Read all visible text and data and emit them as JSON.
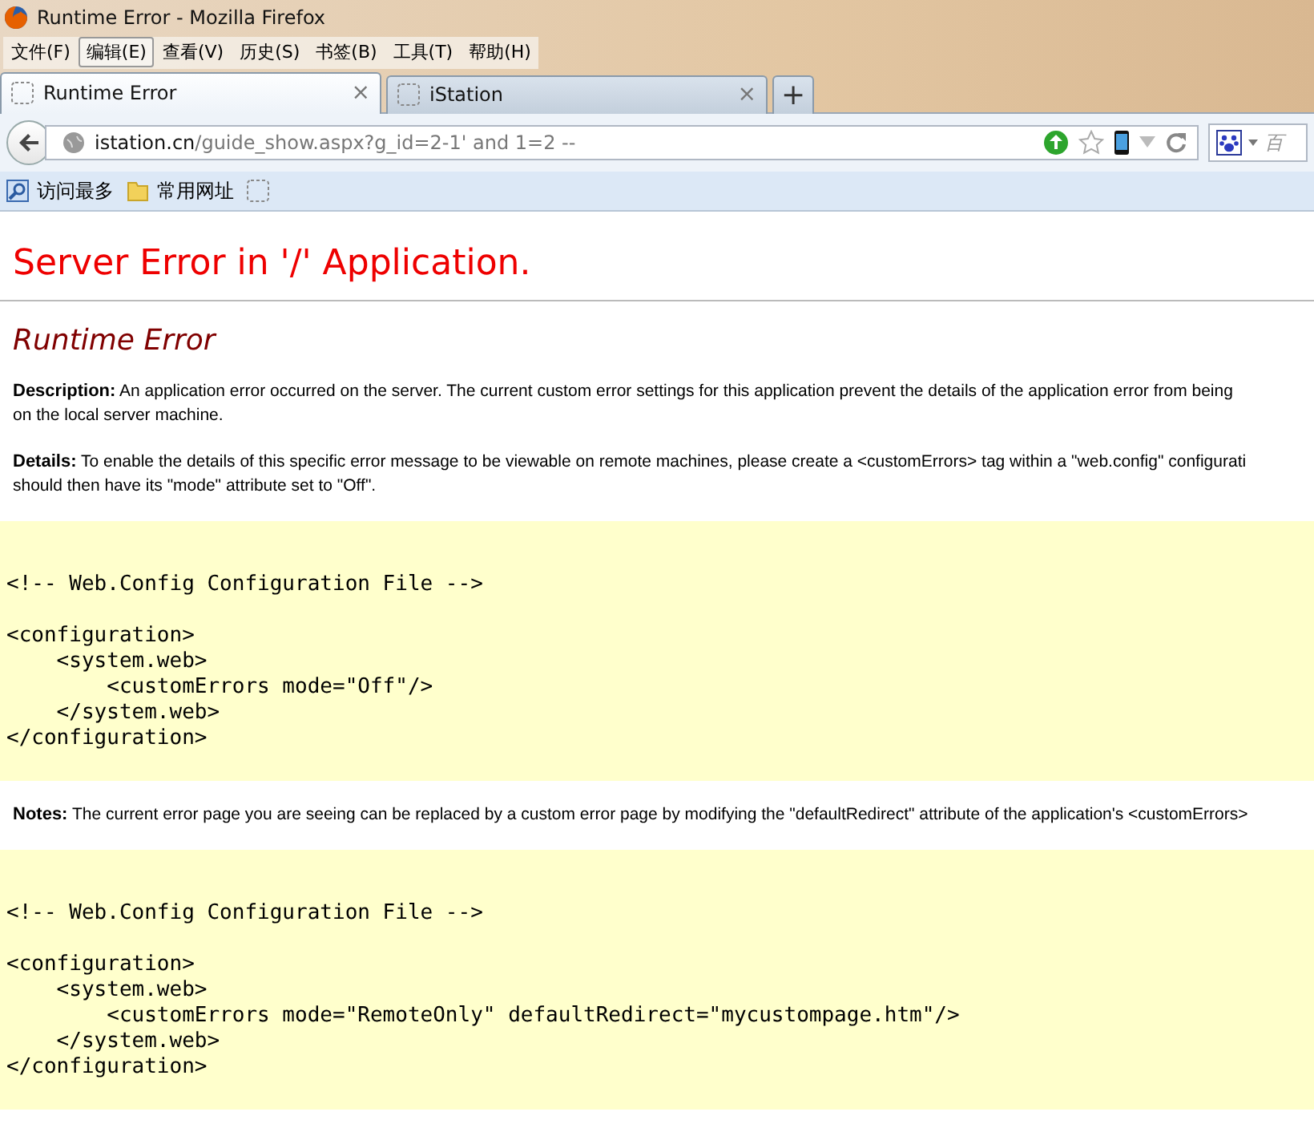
{
  "window": {
    "title": "Runtime Error - Mozilla Firefox"
  },
  "menu": [
    {
      "label": "文件(F)",
      "hovered": false
    },
    {
      "label": "编辑(E)",
      "hovered": true
    },
    {
      "label": "查看(V)",
      "hovered": false
    },
    {
      "label": "历史(S)",
      "hovered": false
    },
    {
      "label": "书签(B)",
      "hovered": false
    },
    {
      "label": "工具(T)",
      "hovered": false
    },
    {
      "label": "帮助(H)",
      "hovered": false
    }
  ],
  "tabs": [
    {
      "label": "Runtime Error",
      "selected": true,
      "close": "×"
    },
    {
      "label": "iStation",
      "selected": false,
      "close": "×"
    }
  ],
  "new_tab": "+",
  "address": {
    "host": "istation.cn",
    "path": "/guide_show.aspx?g_id=2-1' and 1=2 --"
  },
  "search": {
    "placeholder": "百"
  },
  "bookmarks": [
    {
      "label": "访问最多",
      "kind": "smart"
    },
    {
      "label": "常用网址",
      "kind": "folder"
    }
  ],
  "page": {
    "heading": "Server Error in '/' Application.",
    "subheading": "Runtime Error",
    "sections": [
      {
        "kind": "text",
        "label": "Description:",
        "lines": [
          "An application error occurred on the server. The current custom error settings for this application prevent the details of the application error from being",
          "on the local server machine."
        ]
      },
      {
        "kind": "text",
        "label": "Details:",
        "lines": [
          "To enable the details of this specific error message to be viewable on remote machines, please create a <customErrors> tag within a \"web.config\" configurati",
          "should then have its \"mode\" attribute set to \"Off\"."
        ]
      },
      {
        "kind": "code",
        "groups": [
          [
            "<!-- Web.Config Configuration File -->"
          ],
          [
            "<configuration>",
            "    <system.web>",
            "        <customErrors mode=\"Off\"/>",
            "    </system.web>",
            "</configuration>"
          ]
        ]
      },
      {
        "kind": "text",
        "label": "Notes:",
        "lines": [
          "The current error page you are seeing can be replaced by a custom error page by modifying the \"defaultRedirect\" attribute of the application's <customErrors>"
        ]
      },
      {
        "kind": "code",
        "groups": [
          [
            "<!-- Web.Config Configuration File -->"
          ],
          [
            "<configuration>",
            "    <system.web>",
            "        <customErrors mode=\"RemoteOnly\" defaultRedirect=\"mycustompage.htm\"/>",
            "    </system.web>",
            "</configuration>"
          ]
        ]
      }
    ]
  }
}
